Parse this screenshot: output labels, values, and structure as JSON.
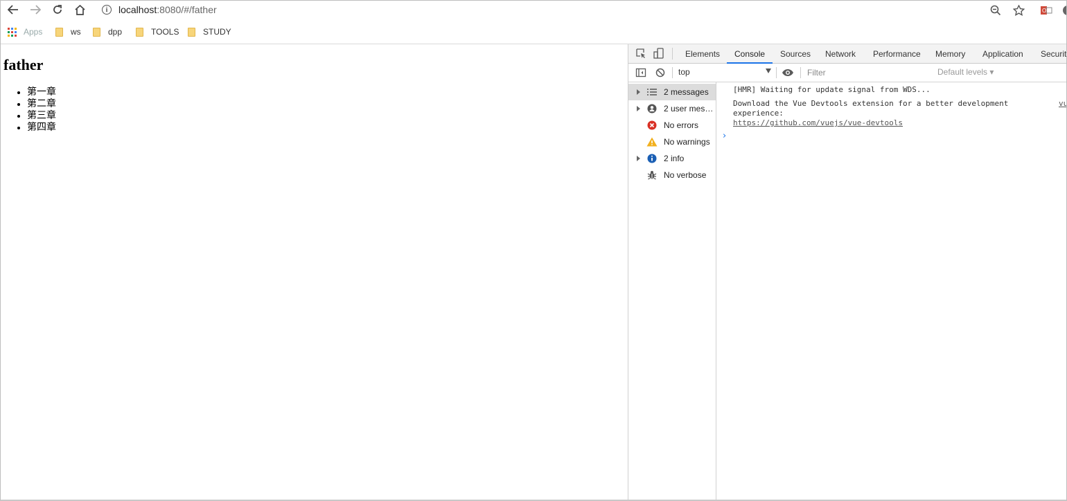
{
  "browser": {
    "url_host": "localhost",
    "url_path": ":8080/#/father",
    "bookmarks": [
      {
        "label": "Apps"
      },
      {
        "label": "ws"
      },
      {
        "label": "dpp"
      },
      {
        "label": "TOOLS"
      },
      {
        "label": "STUDY"
      }
    ],
    "icons": [
      "back-icon",
      "forward-icon",
      "reload-icon",
      "home-icon",
      "info-icon",
      "zoom-icon",
      "star-icon",
      "extension-icon",
      "profile-icon"
    ]
  },
  "page": {
    "heading": "father",
    "chapters": [
      "第一章",
      "第二章",
      "第三章",
      "第四章"
    ]
  },
  "devtools": {
    "tabs": [
      "Elements",
      "Console",
      "Sources",
      "Network",
      "Performance",
      "Memory",
      "Application",
      "Security"
    ],
    "active_tab": "Console",
    "context": "top",
    "filter_placeholder": "Filter",
    "levels": "Default levels ▾",
    "sidebar": [
      {
        "label": "2 messages",
        "icon": "list-icon",
        "selected": true
      },
      {
        "label": "2 user mess...",
        "icon": "user-icon"
      },
      {
        "label": "No errors",
        "icon": "error-icon"
      },
      {
        "label": "No warnings",
        "icon": "warning-icon"
      },
      {
        "label": "2 info",
        "icon": "info-icon"
      },
      {
        "label": "No verbose",
        "icon": "bug-icon"
      }
    ],
    "messages": [
      {
        "text": "[HMR] Waiting for update signal from WDS..."
      },
      {
        "text": "Download the Vue Devtools extension for a better development",
        "text2": "experience:",
        "link": "https://github.com/vuejs/vue-devtools",
        "source": "vue"
      }
    ],
    "prompt": "›"
  },
  "colors": {
    "accent": "#1a73e8",
    "error": "#d93025",
    "warning": "#f2b01e",
    "info": "#1a5fb4"
  }
}
